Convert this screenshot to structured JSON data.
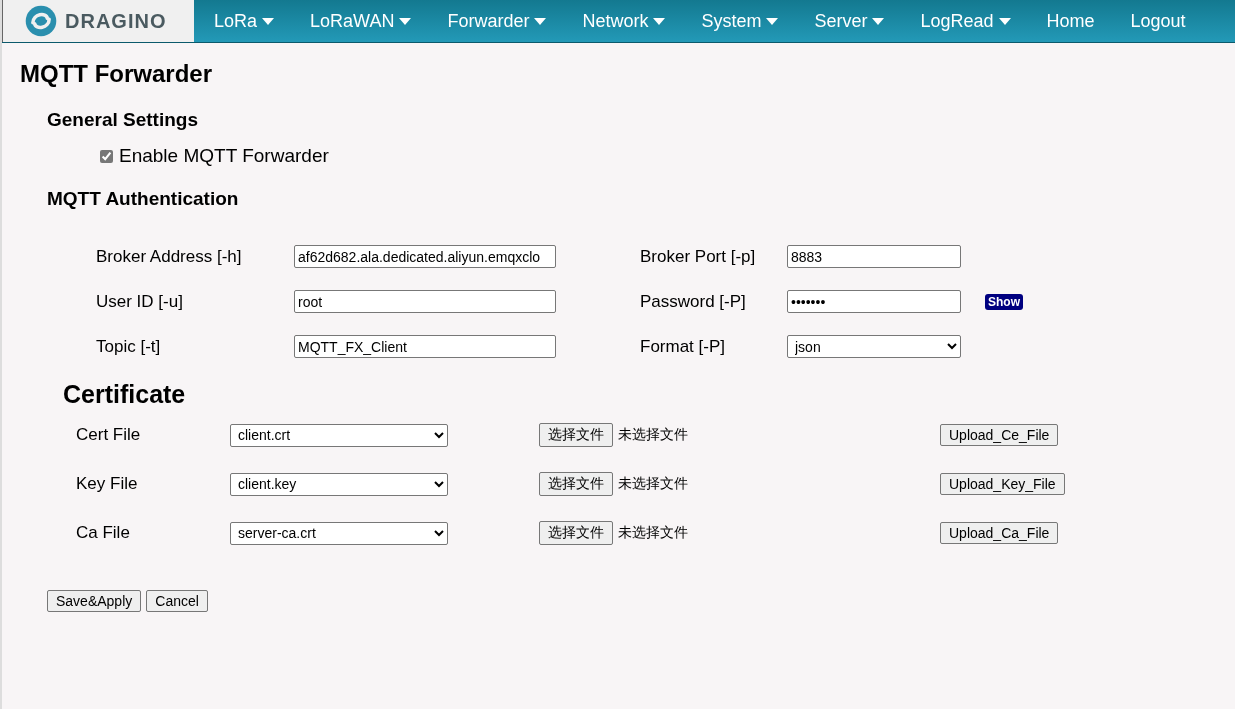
{
  "nav": {
    "logo_text": "DRAGINO",
    "items": [
      {
        "label": "LoRa",
        "dropdown": true
      },
      {
        "label": "LoRaWAN",
        "dropdown": true
      },
      {
        "label": "Forwarder",
        "dropdown": true
      },
      {
        "label": "Network",
        "dropdown": true
      },
      {
        "label": "System",
        "dropdown": true
      },
      {
        "label": "Server",
        "dropdown": true
      },
      {
        "label": "LogRead",
        "dropdown": true
      },
      {
        "label": "Home",
        "dropdown": false
      },
      {
        "label": "Logout",
        "dropdown": false
      }
    ]
  },
  "page_title": "MQTT Forwarder",
  "general": {
    "heading": "General Settings",
    "enable": {
      "label": "Enable MQTT Forwarder",
      "checked": true
    }
  },
  "auth": {
    "heading": "MQTT Authentication",
    "rows": [
      {
        "left": {
          "label": "Broker Address [-h]",
          "value": "af62d682.ala.dedicated.aliyun.emqxclo"
        },
        "right": {
          "label": "Broker Port [-p]",
          "kind": "text",
          "value": "8883"
        }
      },
      {
        "left": {
          "label": "User ID [-u]",
          "value": "root"
        },
        "right": {
          "label": "Password [-P]",
          "kind": "password",
          "value": "•••••••",
          "action": "Show"
        }
      },
      {
        "left": {
          "label": "Topic [-t]",
          "value": "MQTT_FX_Client"
        },
        "right": {
          "label": "Format [-P]",
          "kind": "select",
          "value": "json"
        }
      }
    ]
  },
  "certificate": {
    "heading": "Certificate",
    "rows": [
      {
        "label": "Cert File",
        "selected_file": "client.crt",
        "choose_button": "选择文件",
        "choose_status": "未选择文件",
        "upload_button": "Upload_Ce_File"
      },
      {
        "label": "Key File",
        "selected_file": "client.key",
        "choose_button": "选择文件",
        "choose_status": "未选择文件",
        "upload_button": "Upload_Key_File"
      },
      {
        "label": "Ca File",
        "selected_file": "server-ca.crt",
        "choose_button": "选择文件",
        "choose_status": "未选择文件",
        "upload_button": "Upload_Ca_File"
      }
    ]
  },
  "buttons": [
    "Save&Apply",
    "Cancel"
  ]
}
